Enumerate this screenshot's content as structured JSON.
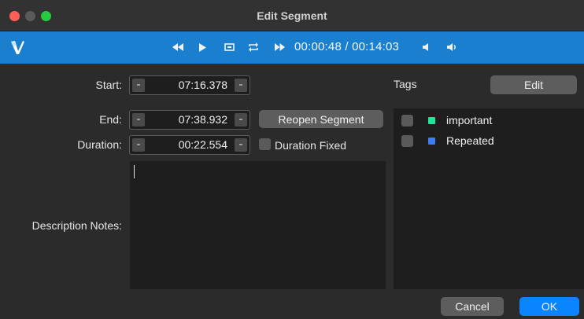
{
  "window": {
    "title": "Edit Segment"
  },
  "transport": {
    "rewind_icon": "◀◀",
    "play_icon": "▶",
    "loop_segment_icon": "⌶",
    "loop_icon": "⟲",
    "forward_icon": "▶▶",
    "timecode": "00:00:48 / 00:14:03",
    "volume_down_icon": "•",
    "volume_up_icon": "•"
  },
  "form": {
    "start_label": "Start:",
    "start_value": "07:16.378",
    "end_label": "End:",
    "end_value": "07:38.932",
    "duration_label": "Duration:",
    "duration_value": "00:22.554",
    "reopen_label": "Reopen Segment",
    "duration_fixed_label": "Duration Fixed",
    "notes_label": "Description Notes:",
    "notes_value": ""
  },
  "tags": {
    "header": "Tags",
    "edit_label": "Edit",
    "items": [
      {
        "label": "important",
        "color": "#22e39a",
        "checked": false
      },
      {
        "label": "Repeated",
        "color": "#3d7cf5",
        "checked": false
      }
    ]
  },
  "footer": {
    "cancel_label": "Cancel",
    "ok_label": "OK"
  },
  "colors": {
    "toolbar": "#1b7fd0",
    "ok_button": "#0b84ff"
  }
}
